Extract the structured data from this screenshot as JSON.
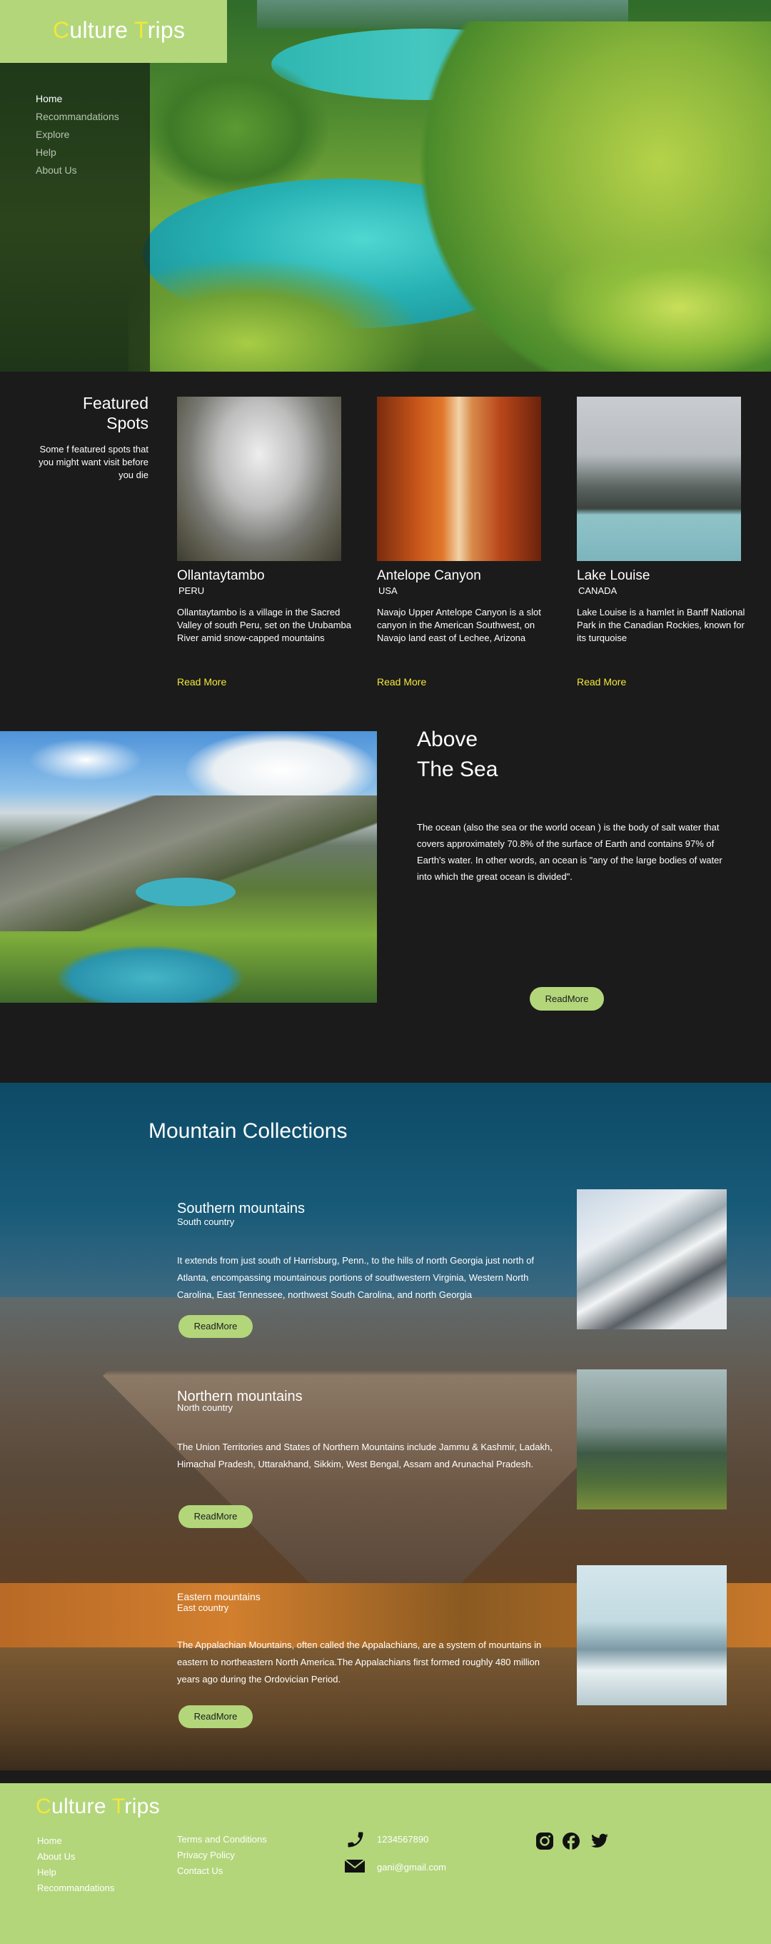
{
  "brand": {
    "first_letter": "C",
    "first_rest": "ulture ",
    "second_letter": "T",
    "second_rest": "rips"
  },
  "nav": {
    "items": [
      "Home",
      "Recommandations",
      "Explore",
      "Help",
      "About Us"
    ]
  },
  "featured": {
    "title_line1": "Featured",
    "title_line2": "Spots",
    "subtitle": "Some f featured spots that you might want visit before you die",
    "cards": [
      {
        "name": "Ollantaytambo",
        "country": "PERU",
        "description": "Ollantaytambo is a village in the Sacred Valley of south Peru, set on the Urubamba River amid snow-capped mountains",
        "link": "Read More"
      },
      {
        "name": "Antelope Canyon",
        "country": "USA",
        "description": "Navajo Upper Antelope Canyon is a slot canyon in the American Southwest, on Navajo land east of Lechee, Arizona",
        "link": "Read More"
      },
      {
        "name": "Lake Louise",
        "country": "CANADA",
        "description": "Lake Louise is a hamlet in Banff National Park in the Canadian Rockies, known for its turquoise",
        "link": "Read More"
      }
    ]
  },
  "sea": {
    "title_line1": "Above",
    "title_line2": "The Sea",
    "text": "The ocean (also the sea or the world ocean ) is the body of salt water that covers approximately 70.8% of the surface of Earth and contains 97% of Earth's water. In other words, an ocean is \"any of the large bodies of water into which the great ocean is divided\".",
    "button": "ReadMore"
  },
  "mountains": {
    "title": "Mountain Collections",
    "items": [
      {
        "name": "Southern mountains",
        "country": "South country",
        "text": "It extends from just south of Harrisburg, Penn., to the hills of north Georgia just north of Atlanta, encompassing mountainous portions of southwestern Virginia, Western North Carolina, East Tennessee, northwest South Carolina, and north Georgia",
        "button": "ReadMore"
      },
      {
        "name": "Northern mountains",
        "country": "North country",
        "text": "The Union Territories and States of Northern Mountains include Jammu & Kashmir, Ladakh, Himachal Pradesh, Uttarakhand, Sikkim, West Bengal, Assam and Arunachal Pradesh.",
        "button": "ReadMore"
      },
      {
        "name": "Eastern mountains",
        "country": "East country",
        "text": "The Appalachian Mountains, often called the Appalachians, are a system of mountains in eastern to northeastern North America.The Appalachians first formed roughly 480 million years ago during the Ordovician Period.",
        "button": "ReadMore"
      }
    ]
  },
  "footer": {
    "col1": [
      "Home",
      "About Us",
      "Help",
      "Recommandations"
    ],
    "col2": [
      "Terms and Conditions",
      "Privacy Policy",
      "Contact Us"
    ],
    "phone": "1234567890",
    "email": "gani@gmail.com",
    "social_icons": [
      "instagram-icon",
      "facebook-icon",
      "twitter-icon"
    ]
  },
  "colors": {
    "accent_green": "#b3d67b",
    "accent_yellow": "#f1e83a",
    "dark_bg": "#1b1b1b"
  }
}
